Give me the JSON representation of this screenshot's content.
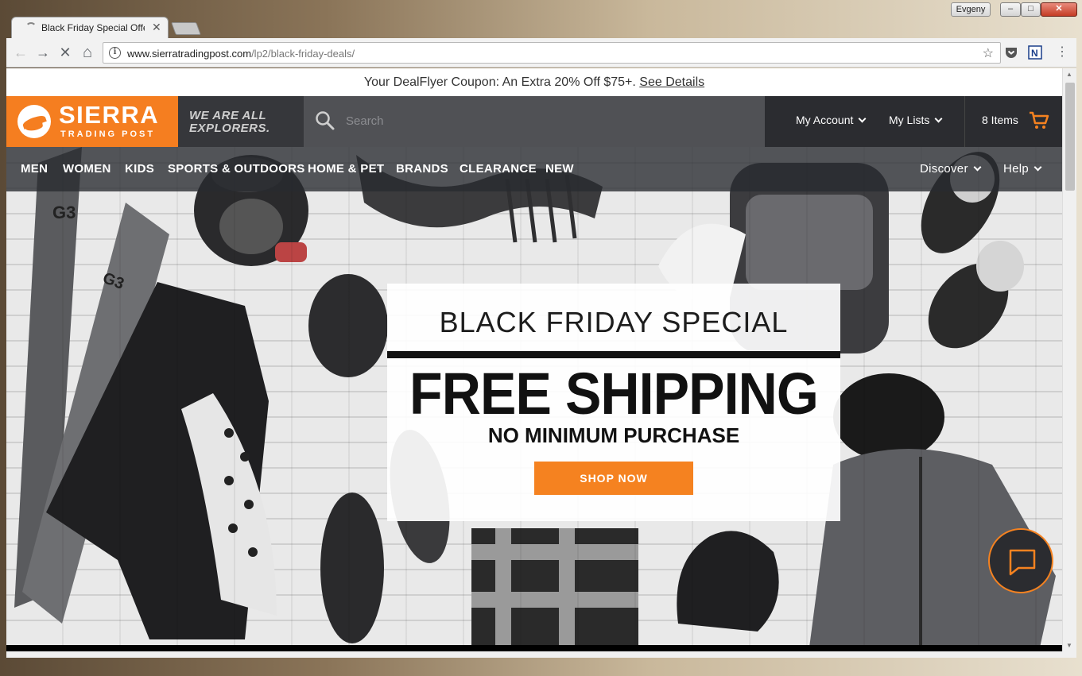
{
  "window": {
    "user": "Evgeny",
    "minimize": "–",
    "maximize": "□",
    "close": "✕"
  },
  "tab": {
    "title": "Black Friday Special Offe",
    "close": "✕"
  },
  "toolbar": {
    "back": "←",
    "forward": "→",
    "stop": "✕",
    "home": "⌂",
    "url_host": "www.sierratradingpost.com",
    "url_path": "/lp2/black-friday-deals/",
    "star": "☆",
    "menu": "⋮"
  },
  "promo_bar": {
    "text": "Your DealFlyer Coupon: An Extra 20% Off $75+.",
    "link": "See Details"
  },
  "header": {
    "logo_big": "SIERRA",
    "logo_small": "TRADING POST",
    "tagline_line1": "WE ARE ALL",
    "tagline_line2": "EXPLORERS.",
    "search_placeholder": "Search",
    "account": "My Account",
    "lists": "My Lists",
    "cart": "8 Items"
  },
  "nav": {
    "items": [
      "MEN",
      "WOMEN",
      "KIDS",
      "SPORTS & OUTDOORS",
      "HOME & PET",
      "BRANDS",
      "CLEARANCE",
      "NEW"
    ],
    "discover": "Discover",
    "help": "Help"
  },
  "hero": {
    "eyebrow": "BLACK FRIDAY SPECIAL",
    "title": "FREE SHIPPING",
    "subtitle": "NO MINIMUM PURCHASE",
    "cta": "SHOP NOW"
  },
  "colors": {
    "brand_orange": "#f57e20",
    "header_dark": "#2b2c30"
  }
}
